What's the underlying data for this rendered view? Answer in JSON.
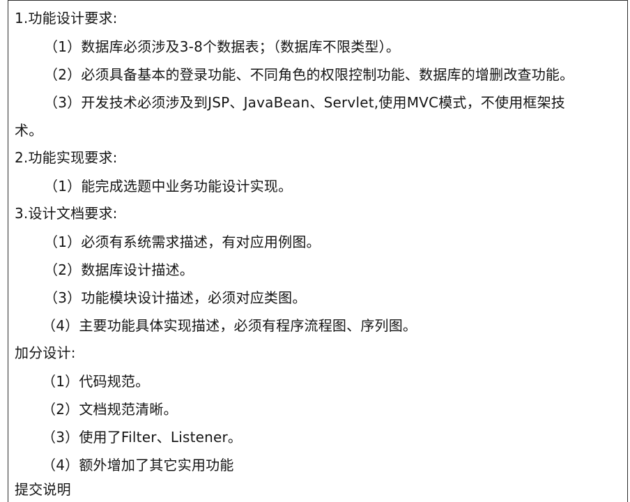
{
  "sections": [
    {
      "title": "1.功能设计要求:",
      "items": [
        "（1）数据库必须涉及3-8个数据表；（数据库不限类型）。",
        "（2）必须具备基本的登录功能、不同角色的权限控制功能、数据库的增删改查功能。",
        "（3）开发技术必须涉及到JSP、JavaBean、Servlet,使用MVC模式，不使用框架技"
      ],
      "continuation": "术。"
    },
    {
      "title": "2.功能实现要求:",
      "items": [
        "（1）能完成选题中业务功能设计实现。"
      ]
    },
    {
      "title": "3.设计文档要求:",
      "items": [
        "（1）必须有系统需求描述，有对应用例图。",
        "（2）数据库设计描述。",
        "（3）功能模块设计描述，必须对应类图。",
        "（4）主要功能具体实现描述，必须有程序流程图、序列图。"
      ]
    },
    {
      "title": "加分设计:",
      "items": [
        "（1）代码规范。",
        "（2）文档规范清晰。",
        "（3）使用了Filter、Listener。",
        "（4）额外增加了其它实用功能"
      ]
    }
  ],
  "cut_off_heading": "提交说明"
}
